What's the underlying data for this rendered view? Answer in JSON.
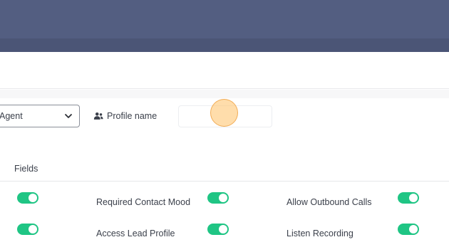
{
  "filters": {
    "role_select": {
      "value": "Agent"
    },
    "profile_name": {
      "label": "Profile name",
      "placeholder": "",
      "value": ""
    }
  },
  "fields": {
    "heading": "Fields"
  },
  "permissions": {
    "row1": {
      "col1": {
        "label": "",
        "enabled": true
      },
      "col2": {
        "label": "Required Contact Mood",
        "enabled": true
      },
      "col3": {
        "label": "Allow Outbound Calls",
        "enabled": true
      }
    },
    "row2": {
      "col1": {
        "label": "",
        "enabled": true
      },
      "col2": {
        "label": "Access Lead Profile",
        "enabled": true
      },
      "col3": {
        "label": "Listen Recording",
        "enabled": true
      }
    }
  },
  "colors": {
    "header": "#535e81",
    "header_sub": "#4b5576",
    "toggle_on": "#1fc584",
    "cursor_highlight": "#ffc878"
  },
  "icons": [
    "chevron-down-icon",
    "users-icon"
  ]
}
